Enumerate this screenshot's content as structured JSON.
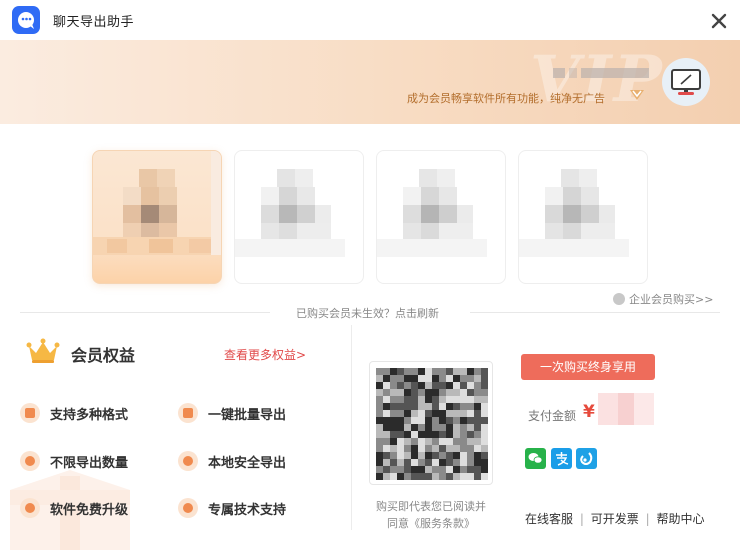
{
  "window": {
    "title": "聊天导出助手"
  },
  "banner": {
    "slogan": "成为会员畅享软件所有功能，纯净无广告",
    "watermark": "VIP"
  },
  "plans": {
    "refresh_hint": "已购买会员未生效？点击刷新",
    "enterprise_link": "企业会员购买>>"
  },
  "benefits": {
    "title": "会员权益",
    "more_link": "查看更多权益>",
    "items": [
      {
        "label": "支持多种格式"
      },
      {
        "label": "一键批量导出"
      },
      {
        "label": "不限导出数量"
      },
      {
        "label": "本地安全导出"
      },
      {
        "label": "软件免费升级"
      },
      {
        "label": "专属技术支持"
      }
    ]
  },
  "payment": {
    "buy_button": "一次购买终身享用",
    "amount_label": "支付金额",
    "currency": "¥",
    "agreement_line1": "购买即代表您已阅读并",
    "agreement_line2": "同意《服务条款》",
    "methods": [
      "wechat-pay",
      "alipay",
      "other-pay"
    ]
  },
  "footer": {
    "links": [
      "在线客服",
      "可开发票",
      "帮助中心"
    ],
    "separator": "|"
  },
  "colors": {
    "accent_blue": "#2f6bf5",
    "buy_button": "#ee6c5b",
    "price_red": "#e64a3c",
    "slogan_brown": "#b36e2c",
    "link_red": "#e14a4a"
  }
}
